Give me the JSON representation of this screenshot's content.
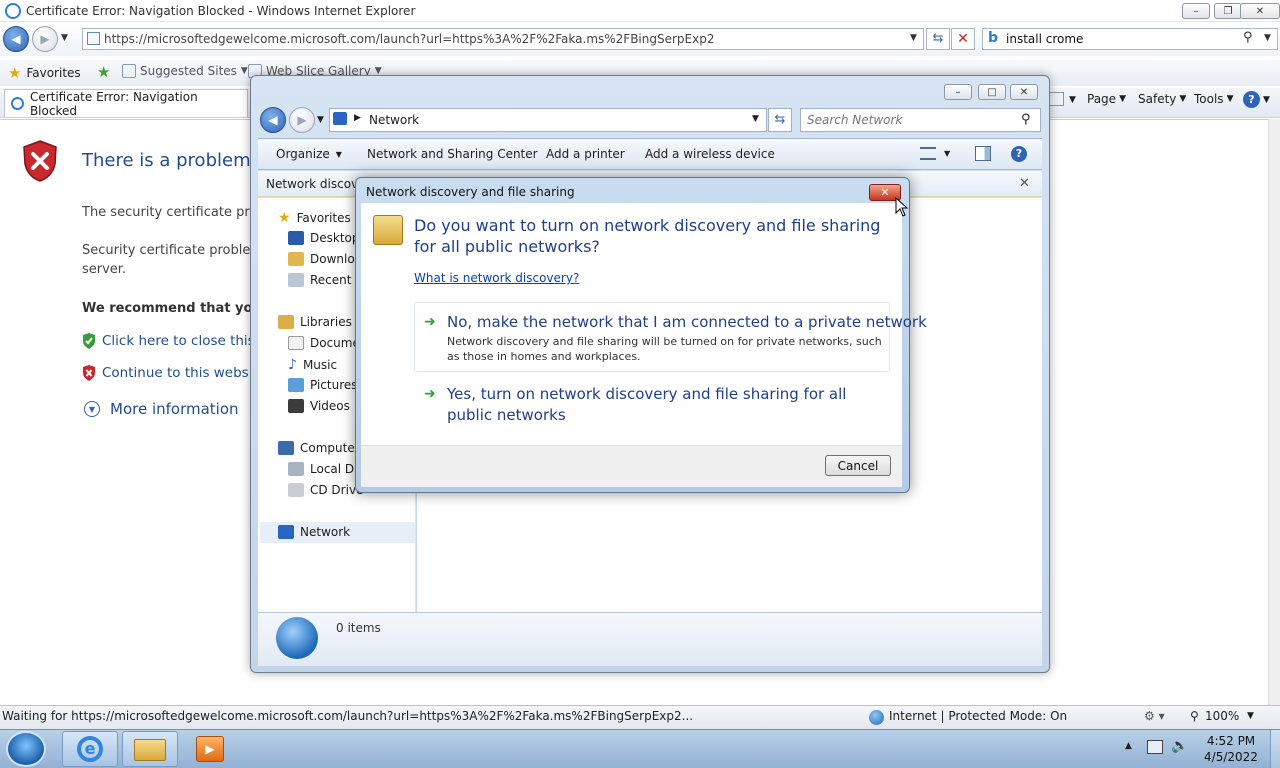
{
  "browser": {
    "title": "Certificate Error: Navigation Blocked - Windows Internet Explorer",
    "url": "https://microsoftedgewelcome.microsoft.com/launch?url=https%3A%2F%2Faka.ms%2FBingSerpExp2",
    "search_value": "install crome",
    "favorites_label": "Favorites",
    "suggested_sites": "Suggested Sites",
    "web_slice_gallery": "Web Slice Gallery",
    "tab_title": "Certificate Error: Navigation Blocked",
    "commands": {
      "page": "Page",
      "safety": "Safety",
      "tools": "Tools"
    }
  },
  "cert_page": {
    "heading": "There is a problem wi",
    "line1": "The security certificate prese",
    "line2a": "Security certificate problems",
    "line2b": "server.",
    "recommend": "We recommend that you",
    "close_link": "Click here to close this w",
    "continue_link": "Continue to this website",
    "more_info": "More information"
  },
  "statusbar": {
    "text": "Waiting for https://microsoftedgewelcome.microsoft.com/launch?url=https%3A%2F%2Faka.ms%2FBingSerpExp2...",
    "zone": "Internet | Protected Mode: On",
    "zoom": "100%"
  },
  "taskbar": {
    "time": "4:52 PM",
    "date": "4/5/2022"
  },
  "explorer": {
    "location": "Network",
    "search_placeholder": "Search Network",
    "commands": {
      "organize": "Organize",
      "network_sharing_center": "Network and Sharing Center",
      "add_printer": "Add a printer",
      "add_wireless": "Add a wireless device"
    },
    "infobar_text": "Network discove",
    "nav": {
      "favorites": "Favorites",
      "desktop": "Desktop",
      "downloads": "Downloa",
      "recent": "Recent P",
      "libraries": "Libraries",
      "documents": "Docume",
      "music": "Music",
      "pictures": "Pictures",
      "videos": "Videos",
      "computer": "Computer",
      "local_disk": "Local Dis",
      "cd_drive": "CD Drive",
      "network": "Network"
    },
    "item_count": "0 items"
  },
  "dialog": {
    "title": "Network discovery and file sharing",
    "question": "Do you want to turn on network discovery and file sharing for all public networks?",
    "help_link": "What is network discovery?",
    "option1_title": "No, make the network that I am connected to a private network",
    "option1_desc": "Network discovery and file sharing will be turned on for private networks, such as those in homes and workplaces.",
    "option2_title": "Yes, turn on network discovery and file sharing for all public networks",
    "cancel": "Cancel"
  },
  "colors": {
    "link_blue": "#1f4e8e",
    "dialog_heading": "#1f3f8a",
    "close_red": "#c4361c",
    "arrow_green": "#2aa33a"
  }
}
